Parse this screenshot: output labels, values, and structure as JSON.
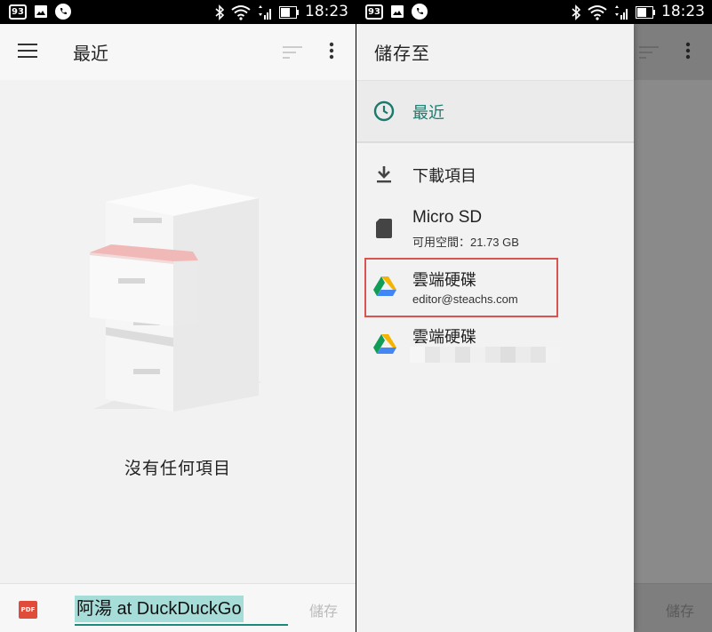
{
  "status_bar": {
    "badge": "93",
    "time": "18:23"
  },
  "left": {
    "app_title": "最近",
    "empty_message": "沒有任何項目",
    "file_type": "PDF",
    "filename": "阿湯 at DuckDuckGo",
    "save_label": "儲存"
  },
  "right": {
    "drawer_title": "儲存至",
    "recent_label": "最近",
    "downloads_label": "下載項目",
    "sd_label": "Micro SD",
    "sd_sub": "可用空間：21.73 GB",
    "drive1_label": "雲端硬碟",
    "drive1_sub": "editor@steachs.com",
    "drive2_label": "雲端硬碟",
    "save_label": "儲存"
  },
  "colors": {
    "accent": "#1a7a6d",
    "highlight_box": "#d9534f",
    "pdf_red": "#e04b3a"
  }
}
